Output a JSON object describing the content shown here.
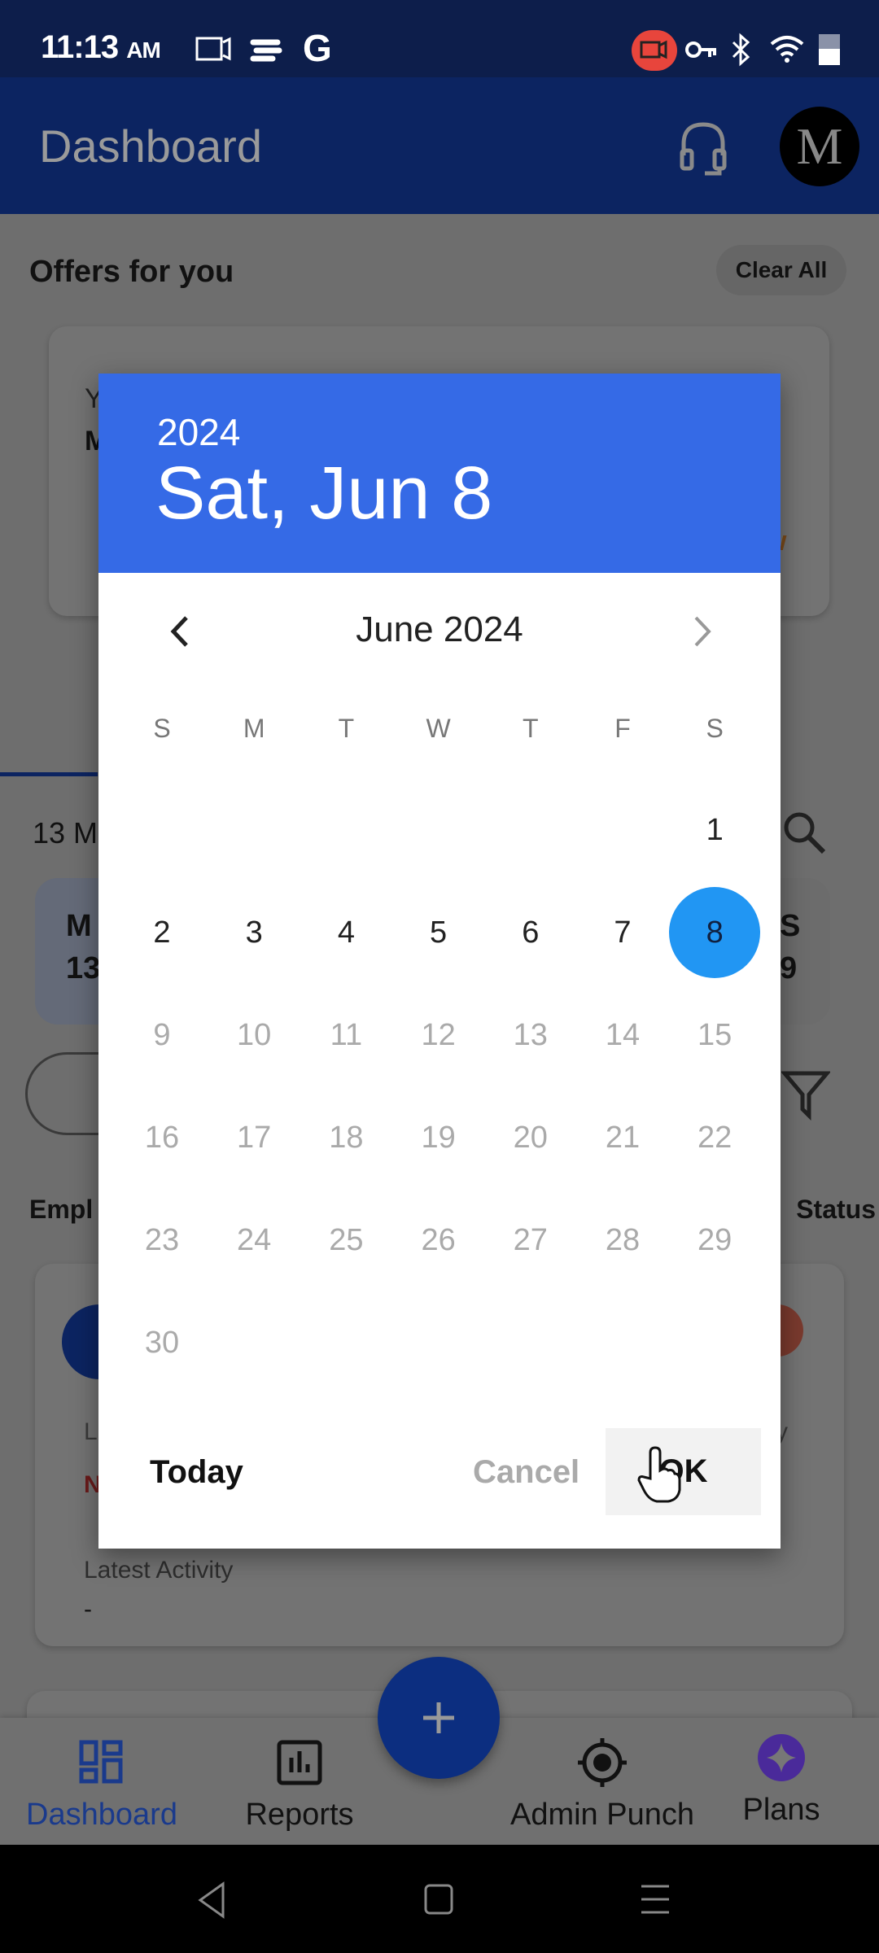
{
  "status_bar": {
    "time": "11:13",
    "ampm": "AM",
    "left_icons": [
      "screen-record-icon",
      "sync-icon",
      "google-icon"
    ],
    "right_icons": [
      "recording-icon",
      "vpn-key-icon",
      "bluetooth-icon",
      "wifi-icon",
      "battery-icon"
    ],
    "recording_color": "#e8453c"
  },
  "app_bar": {
    "title": "Dashboard",
    "icons": [
      "headset-icon",
      "avatar"
    ]
  },
  "background": {
    "offers_title": "Offers for you",
    "clear_all": "Clear All",
    "offer_card_partial": [
      "Y",
      "M",
      "w"
    ],
    "date_partial": "13 M",
    "summary_left": [
      "M",
      "13"
    ],
    "summary_right": [
      "S",
      "9"
    ],
    "list_header_left": "Empl",
    "list_header_right": "Status",
    "employee_card": {
      "line1": "L",
      "line2": "N",
      "right": "y",
      "latest_activity_label": "Latest Activity",
      "latest_activity_value": "-"
    }
  },
  "date_picker": {
    "year": "2024",
    "selected_label": "Sat, Jun 8",
    "month_label": "June 2024",
    "weekdays": [
      "S",
      "M",
      "T",
      "W",
      "T",
      "F",
      "S"
    ],
    "first_weekday_index": 6,
    "days_in_month": 30,
    "selected_day": 8,
    "max_enabled_day": 8,
    "today": "Today",
    "cancel": "Cancel",
    "ok": "OK",
    "header_color": "#356ae6",
    "selected_color": "#2196f3"
  },
  "bottom_nav": {
    "items": [
      {
        "label": "Dashboard",
        "icon": "dashboard-grid-icon",
        "active": true
      },
      {
        "label": "Reports",
        "icon": "bar-chart-icon"
      },
      {
        "label": "Admin Punch",
        "icon": "location-target-icon"
      },
      {
        "label": "Plans",
        "icon": "sparkle-icon"
      }
    ],
    "fab": "plus-icon",
    "active_color": "#1c4fcf"
  },
  "system_nav": [
    "back-icon",
    "home-icon",
    "recents-icon"
  ]
}
